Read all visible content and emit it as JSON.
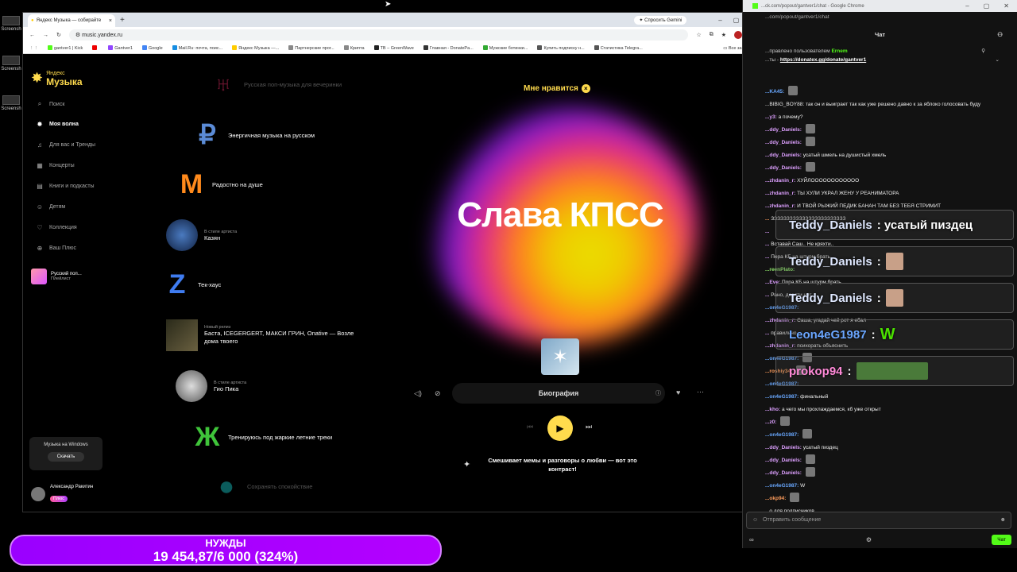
{
  "desktop": {
    "items": [
      "Screensh",
      "Screensh",
      "Screensh"
    ]
  },
  "browser": {
    "tab_title": "Яндекс Музыка — собирайте",
    "gemini_label": "Спросить Gemini",
    "url": "music.yandex.ru",
    "bookmarks": [
      "gantver1 | Kick",
      "",
      "Gantver1",
      "Google",
      "Mail.Ru: почта, поис...",
      "Яндекс Музыка —...",
      "Партнерские прог...",
      "Крипта",
      "TB – GreenWave",
      "Главная - DonatePa...",
      "Мужские ботинки...",
      "Купить подписку н...",
      "Статистика Telegra..."
    ],
    "bookmarks_all": "Все закладки"
  },
  "sidebar": {
    "logo_top": "Яндекс",
    "logo_bottom": "Музыка",
    "nav": [
      {
        "label": "Поиск",
        "icon": "search-icon"
      },
      {
        "label": "Моя волна",
        "icon": "wave-icon"
      },
      {
        "label": "Для вас и Тренды",
        "icon": "music-note-icon"
      },
      {
        "label": "Концерты",
        "icon": "ticket-icon"
      },
      {
        "label": "Книги и подкасты",
        "icon": "book-icon"
      },
      {
        "label": "Детям",
        "icon": "kids-icon"
      },
      {
        "label": "Коллекция",
        "icon": "heart-icon"
      },
      {
        "label": "Ваш Плюс",
        "icon": "plus-icon"
      }
    ],
    "playlist": {
      "title": "Русский поп...",
      "type": "Плейлист"
    },
    "windows_card": {
      "title": "Музыка на Windows",
      "button": "Скачать"
    },
    "user": {
      "name": "Александр Ракитин",
      "badge": "Плюс"
    }
  },
  "waves": [
    {
      "sub": "",
      "title": "Русская поп-музыка для вечеринки"
    },
    {
      "sub": "",
      "title": "Энергичная музыка на русском"
    },
    {
      "sub": "",
      "title": "Радостно на душе"
    },
    {
      "sub": "В стиле артиста",
      "title": "Казян"
    },
    {
      "sub": "",
      "title": "Тек-хаус"
    },
    {
      "sub": "Новый релиз",
      "title": "Баста, ICEGERGERT, МАКСИ ГРИН, Onative — Возле дома твоего"
    },
    {
      "sub": "В стиле артиста",
      "title": "Гио Пика"
    },
    {
      "sub": "",
      "title": "Тренируюсь под жаркие летние треки"
    },
    {
      "sub": "",
      "title": "Сохранять спокойствие"
    }
  ],
  "player": {
    "like_label": "Мне нравится",
    "artist": "Слава КПСС",
    "bio_label": "Биография",
    "description": "Смешивает мемы и разговоры о любви — вот это контраст!"
  },
  "chat": {
    "window_url": "...ck.com/popout/gantver1/chat - Google Chrome",
    "address": "...com/popout/gantver1/chat",
    "header": "Чат",
    "pinned_prefix": "...правлено пользователем",
    "pinned_user": "Ernem",
    "pinned_line2_prefix": "...ты -",
    "pinned_link": "https://donatex.gg/donate/gantver1",
    "messages": [
      {
        "user": "...KA45:",
        "text": "",
        "cls": "b",
        "emote": true
      },
      {
        "user": "",
        "text": "...BIBIG_BOY88: так он и выиграет так как уже решено давно к за яблоко голосовать буду",
        "cls": "g",
        "emote": false
      },
      {
        "user": "...у3:",
        "text": "а почему?",
        "cls": "",
        "emote": false
      },
      {
        "user": "...ddy_Daniels:",
        "text": "",
        "cls": "",
        "emote": true
      },
      {
        "user": "...ddy_Daniels:",
        "text": "",
        "cls": "",
        "emote": true
      },
      {
        "user": "...ddy_Daniels:",
        "text": "усатый шмель на душистый хмель",
        "cls": "",
        "emote": false
      },
      {
        "user": "...ddy_Daniels:",
        "text": "",
        "cls": "",
        "emote": true
      },
      {
        "user": "...zhdanin_r:",
        "text": "ХУЙЛОООООООООООО",
        "cls": "",
        "emote": false
      },
      {
        "user": "...zhdanin_r:",
        "text": "ТЫ ХУЛИ УКРАЛ ЖЕНУ У РЕАНИМАТОРА",
        "cls": "",
        "emote": false
      },
      {
        "user": "...zhdanin_r:",
        "text": "И ТВОЙ РЫЖИЙ ПЕДИК БАНАН ТАМ БЕЗ ТЕБЯ СТРИМИТ",
        "cls": "",
        "emote": false
      },
      {
        "user": "...",
        "text": "ЗЗЗЗЗЗЗЗЗЗЗЗЗЗЗЗЗЗЗЗЗЗЗЗ",
        "cls": "o",
        "emote": false
      },
      {
        "user": "...",
        "text": "",
        "cls": "",
        "emote": false
      },
      {
        "user": "...",
        "text": "Вставай Саш.. Не кряхти..",
        "cls": "",
        "emote": false
      },
      {
        "user": "...",
        "text": "Пора КБ на штурм брать..",
        "cls": "",
        "emote": false
      },
      {
        "user": "...reenPlato:",
        "text": "",
        "cls": "g",
        "emote": false
      },
      {
        "user": "...Eve:",
        "text": "Пора КБ на штурм брать",
        "cls": "",
        "emote": false
      },
      {
        "user": "...",
        "text": "Рано, девяти нет",
        "cls": "",
        "emote": false
      },
      {
        "user": "...on4eG1987:",
        "text": "",
        "cls": "b",
        "emote": false
      },
      {
        "user": "...zhdanin_r:",
        "text": "Саша, угадай чей рот я ебал",
        "cls": "",
        "emote": false
      },
      {
        "user": "...",
        "text": "правильно",
        "cls": "",
        "emote": false
      },
      {
        "user": "...zhdanin_r:",
        "text": "психорать объяснить",
        "cls": "",
        "emote": false
      },
      {
        "user": "...on4eG1987:",
        "text": "",
        "cls": "b",
        "emote": true
      },
      {
        "user": "...roshiy34:",
        "text": "",
        "cls": "o",
        "emote": true
      },
      {
        "user": "...on4eG1987:",
        "text": "",
        "cls": "b",
        "emote": false
      },
      {
        "user": "...on4eG1987:",
        "text": "финальный",
        "cls": "b",
        "emote": false
      },
      {
        "user": "...kho:",
        "text": "а чего мы прохлаждаемся, кб уже открыт",
        "cls": "",
        "emote": false
      },
      {
        "user": "...z0:",
        "text": "",
        "cls": "",
        "emote": true
      },
      {
        "user": "...on4eG1987:",
        "text": "",
        "cls": "b",
        "emote": true
      },
      {
        "user": "...ddy_Daniels:",
        "text": "усатый пиздец",
        "cls": "",
        "emote": false
      },
      {
        "user": "...ddy_Daniels:",
        "text": "",
        "cls": "",
        "emote": true
      },
      {
        "user": "...ddy_Daniels:",
        "text": "",
        "cls": "",
        "emote": true
      },
      {
        "user": "...on4eG1987:",
        "text": "W",
        "cls": "b",
        "emote": false
      },
      {
        "user": "...okp94:",
        "text": "",
        "cls": "o",
        "emote": true
      },
      {
        "user": "",
        "text": "...о для подписчиков",
        "cls": "",
        "emote": false
      }
    ],
    "overlay": [
      {
        "user": "Teddy_Daniels",
        "text": " : усатый пиздец",
        "box": false,
        "w": false
      },
      {
        "user": "Teddy_Daniels",
        "text": " : ",
        "box": true,
        "w": false
      },
      {
        "user": "Teddy_Daniels",
        "text": " : ",
        "box": true,
        "w": false
      },
      {
        "user": "Leon4eG1987",
        "text": " : ",
        "box": false,
        "w": true
      },
      {
        "user": "prokop94",
        "text": " : ",
        "box": true,
        "w": false
      }
    ],
    "overlay_w": "W",
    "input_placeholder": "Отправить сообщение",
    "send_label": "Чат",
    "footer_left": "∞"
  },
  "donation": {
    "label": "НУЖДЫ",
    "value": "19 454,87/6 000 (324%)"
  }
}
